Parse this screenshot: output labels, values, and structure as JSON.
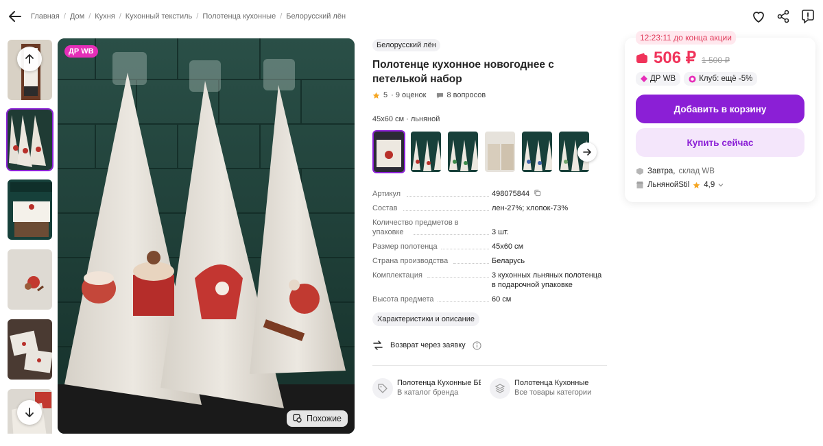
{
  "breadcrumb": [
    "Главная",
    "Дом",
    "Кухня",
    "Кухонный текстиль",
    "Полотенца кухонные",
    "Белорусский лён"
  ],
  "gallery": {
    "badge": "ДР WB",
    "similar_label": "Похожие"
  },
  "product": {
    "brand": "Белорусский лён",
    "title": "Полотенце кухонное новогоднее с петелькой набор",
    "rating": "5",
    "reviews": "· 9 оценок",
    "questions": "8 вопросов",
    "variant_label": "45x60 см · льняной"
  },
  "specs": [
    {
      "name": "Артикул",
      "value": "498075844"
    },
    {
      "name": "Состав",
      "value": "лен-27%; хлопок-73%"
    },
    {
      "name": "Количество предметов в упаковке",
      "value": "3 шт."
    },
    {
      "name": "Размер полотенца",
      "value": "45x60 см"
    },
    {
      "name": "Страна производства",
      "value": "Беларусь"
    },
    {
      "name": "Комплектация",
      "value": "3 кухонных льняных полотенца в подарочной упаковке"
    },
    {
      "name": "Высота предмета",
      "value": "60 см"
    }
  ],
  "chars_button": "Характеристики и описание",
  "return_text": "Возврат через заявку",
  "categories": [
    {
      "title": "Полотенца Кухонные БЕЛОРУССКИЙ ЛЁН",
      "sub": "В каталог бренда"
    },
    {
      "title": "Полотенца Кухонные",
      "sub": "Все товары категории"
    }
  ],
  "offer": {
    "timer": "12:23:11 до конца акции",
    "price": "506 ₽",
    "old_price": "1 500 ₽",
    "badge_dr": "ДР WB",
    "badge_club": "Клуб: ещё -5%",
    "cart_button": "Добавить в корзину",
    "buy_button": "Купить сейчас",
    "delivery_day": "Завтра,",
    "delivery_from": "склад WB",
    "seller": "ЛьнянойStil",
    "seller_rating": "4,9"
  },
  "colors": {
    "accent": "#8b1fd6",
    "price": "#f0335a",
    "badge_dr": "#e62eb8"
  }
}
